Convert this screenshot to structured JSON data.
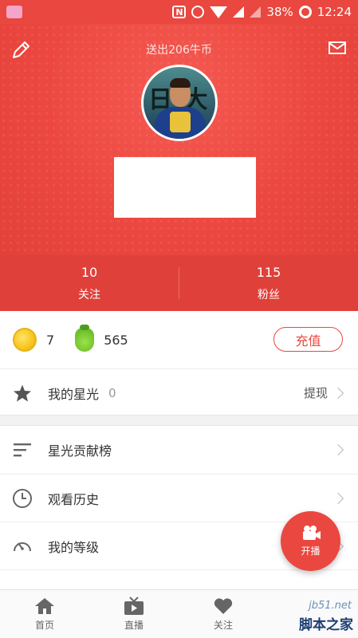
{
  "status_bar": {
    "battery": "38%",
    "time": "12:24"
  },
  "header": {
    "title": "送出206牛币"
  },
  "stats": {
    "following_count": "10",
    "following_label": "关注",
    "fans_count": "115",
    "fans_label": "粉丝"
  },
  "wallet": {
    "coins": "7",
    "beans": "565",
    "recharge_label": "充值"
  },
  "starlight": {
    "label": "我的星光",
    "value": "0",
    "withdraw_label": "提现"
  },
  "menu": {
    "items": [
      {
        "label": "星光贡献榜",
        "icon": "list-icon"
      },
      {
        "label": "观看历史",
        "icon": "clock-icon"
      },
      {
        "label": "我的等级",
        "icon": "gauge-icon"
      }
    ]
  },
  "live_button": {
    "label": "开播"
  },
  "bottom_nav": {
    "items": [
      {
        "label": "首页",
        "icon": "home-icon"
      },
      {
        "label": "直播",
        "icon": "tv-icon"
      },
      {
        "label": "关注",
        "icon": "heart-icon"
      }
    ]
  },
  "watermark": {
    "site": "jb51.net",
    "name": "脚本之家"
  },
  "colors": {
    "brand_red": "#e9473f",
    "stats_red": "#e0403a"
  }
}
